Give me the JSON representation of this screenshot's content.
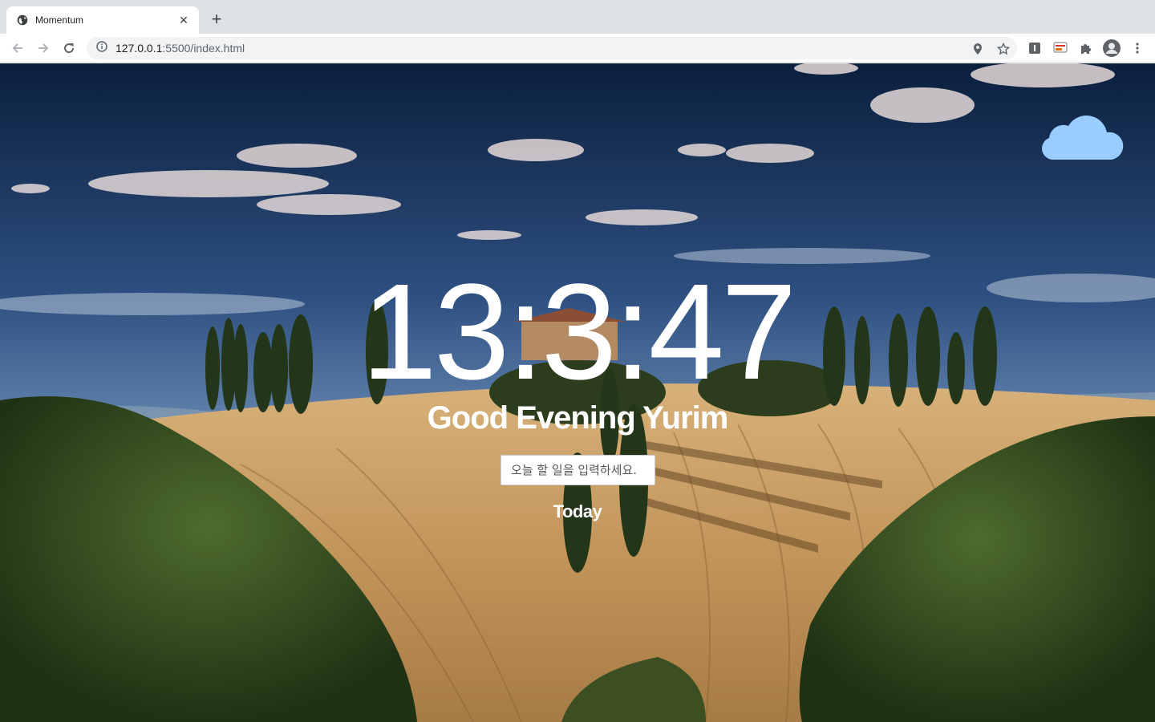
{
  "browser": {
    "tab_title": "Momentum",
    "new_tab": "+",
    "close": "✕",
    "url_host": "127.0.0.1",
    "url_rest": ":5500/index.html"
  },
  "page": {
    "clock": "13:3:47",
    "greeting": "Good Evening Yurim",
    "todo_placeholder": "오늘 할 일을 입력하세요.",
    "today_label": "Today",
    "weather_icon": "cloud-icon"
  },
  "colors": {
    "sky_top": "#0b1f3d",
    "sky_mid": "#4f76a8",
    "field": "#c79a5e",
    "cloud": "#99ccff"
  }
}
